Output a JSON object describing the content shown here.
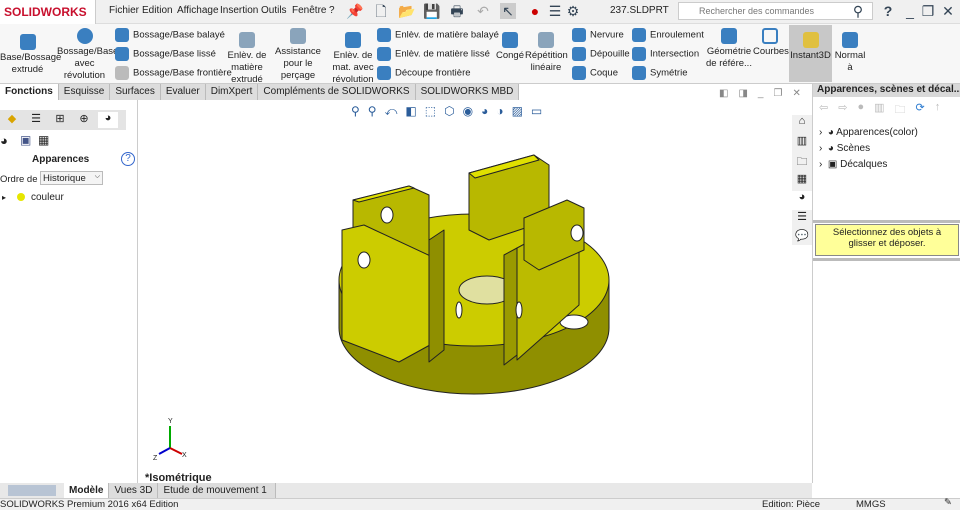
{
  "app": {
    "logo": "SOLIDWORKS",
    "file": "237.SLDPRT"
  },
  "menu": [
    "Fichier",
    "Edition",
    "Affichage",
    "Insertion",
    "Outils",
    "Fenêtre",
    "?"
  ],
  "search": {
    "placeholder": "Rechercher des commandes"
  },
  "ribbon": {
    "base_extrude": "Base/Bossage extrudé",
    "revolve": "Bossage/Base avec révolution",
    "sweep": "Bossage/Base balayé",
    "loft": "Bossage/Base lissé",
    "boundary": "Bossage/Base frontière",
    "cut_extrude": "Enlèv. de matière extrudé",
    "hole": "Assistance pour le perçage",
    "cut_revolve": "Enlèv. de mat. avec révolution",
    "cut_sweep": "Enlèv. de matière balayé",
    "cut_loft": "Enlèv. de matière lissé",
    "cut_boundary": "Découpe frontière",
    "fillet": "Congé",
    "pattern": "Répétition linéaire",
    "rib": "Nervure",
    "draft": "Dépouille",
    "shell": "Coque",
    "wrap": "Enroulement",
    "intersect": "Intersection",
    "mirror": "Symétrie",
    "refgeom": "Géométrie de référe...",
    "curves": "Courbes",
    "instant3d": "Instant3D",
    "normal": "Normal à"
  },
  "tabs": [
    "Fonctions",
    "Esquisse",
    "Surfaces",
    "Evaluer",
    "DimXpert",
    "Compléments de SOLIDWORKS",
    "SOLIDWORKS MBD"
  ],
  "left": {
    "title": "Apparences",
    "sort_label": "Ordre de tri:",
    "sort_value": "Historique",
    "item": "couleur"
  },
  "view": {
    "name": "*Isométrique",
    "axis_x": "X",
    "axis_y": "Y",
    "axis_z": "Z"
  },
  "right": {
    "title": "Apparences, scènes et décal...",
    "items": [
      "Apparences(color)",
      "Scènes",
      "Décalques"
    ],
    "tip": "Sélectionnez des objets à glisser et déposer."
  },
  "bottom_tabs": [
    "Modèle",
    "Vues 3D",
    "Etude de mouvement 1"
  ],
  "status": {
    "left": "SOLIDWORKS Premium 2016 x64 Edition",
    "mode": "Edition: Pièce",
    "units": "MMGS"
  },
  "colors": {
    "part": "#c8c800",
    "accent": "#c8102e"
  }
}
